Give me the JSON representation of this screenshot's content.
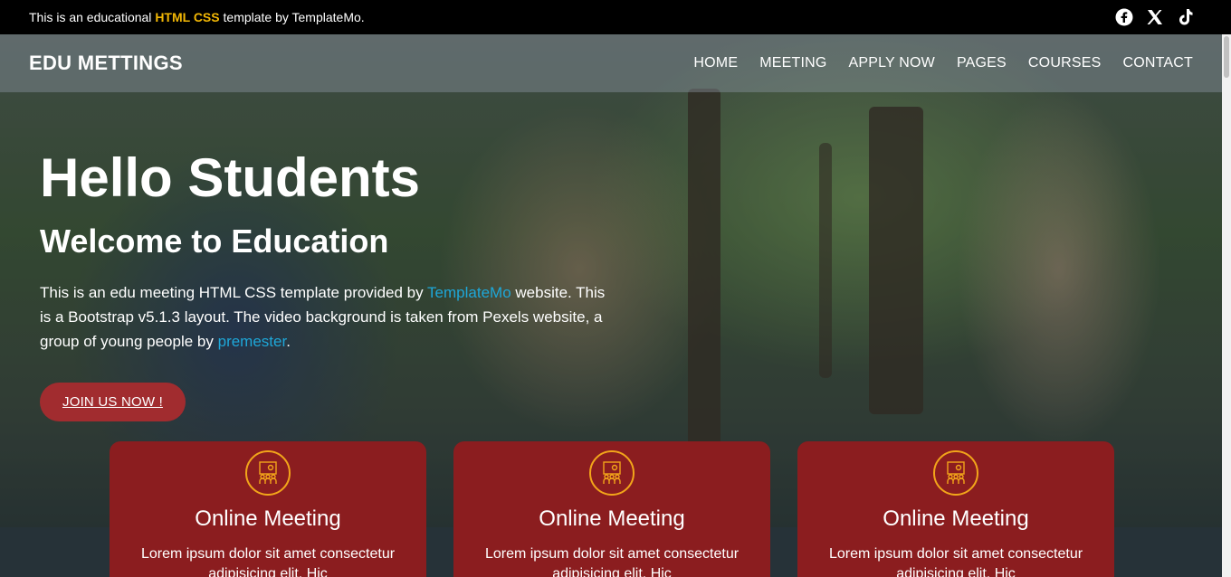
{
  "topbar": {
    "notice_pre": "This is an educational ",
    "notice_highlight": "HTML CSS",
    "notice_post": " template by TemplateMo.",
    "socials": [
      "facebook-icon",
      "x-icon",
      "tiktok-icon"
    ]
  },
  "header": {
    "logo": "EDU METTINGS",
    "nav": [
      "HOME",
      "MEETING",
      "APPLY NOW",
      "PAGES",
      "COURSES",
      "CONTACT"
    ]
  },
  "hero": {
    "title": "Hello Students",
    "subtitle": "Welcome to Education",
    "desc_1": "This is an edu meeting HTML CSS template provided by ",
    "desc_link1": "TemplateMo",
    "desc_2": " website. This is a Bootstrap v5.1.3 layout. The video background is taken from Pexels website, a group of young people by ",
    "desc_link2": "premester",
    "desc_3": ".",
    "button": "JOIN US NOW !"
  },
  "cards": [
    {
      "title": "Online Meeting",
      "text": "Lorem ipsum dolor sit amet consectetur adipisicing elit. Hic"
    },
    {
      "title": "Online Meeting",
      "text": "Lorem ipsum dolor sit amet consectetur adipisicing elit. Hic"
    },
    {
      "title": "Online Meeting",
      "text": "Lorem ipsum dolor sit amet consectetur adipisicing elit. Hic"
    }
  ],
  "colors": {
    "accent": "#f2b705",
    "card": "#8b1d1f",
    "button": "#a12c2f",
    "link": "#1ea7d8"
  }
}
